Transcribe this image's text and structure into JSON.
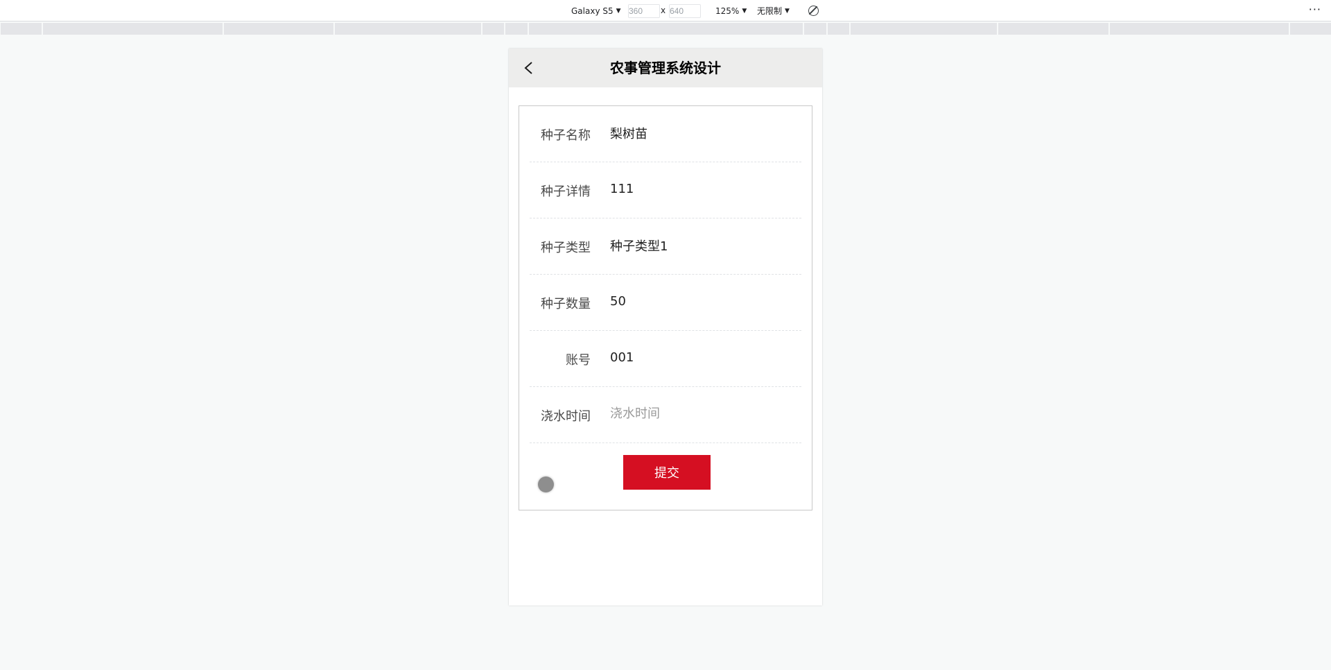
{
  "devtools": {
    "device_name": "Galaxy S5",
    "width_value": "360",
    "height_value": "640",
    "dimension_separator": "x",
    "zoom": "125%",
    "throttling": "无限制",
    "more_label": "···"
  },
  "app": {
    "title": "农事管理系统设计",
    "back_icon": "chevron-left-icon",
    "fields": [
      {
        "label": "种子名称",
        "value": "梨树苗",
        "placeholder": ""
      },
      {
        "label": "种子详情",
        "value": "111",
        "placeholder": ""
      },
      {
        "label": "种子类型",
        "value": "种子类型1",
        "placeholder": ""
      },
      {
        "label": "种子数量",
        "value": "50",
        "placeholder": ""
      },
      {
        "label": "账号",
        "value": "001",
        "placeholder": ""
      },
      {
        "label": "浇水时间",
        "value": "",
        "placeholder": "浇水时间"
      }
    ],
    "submit_label": "提交",
    "accent_color": "#d50f22"
  }
}
